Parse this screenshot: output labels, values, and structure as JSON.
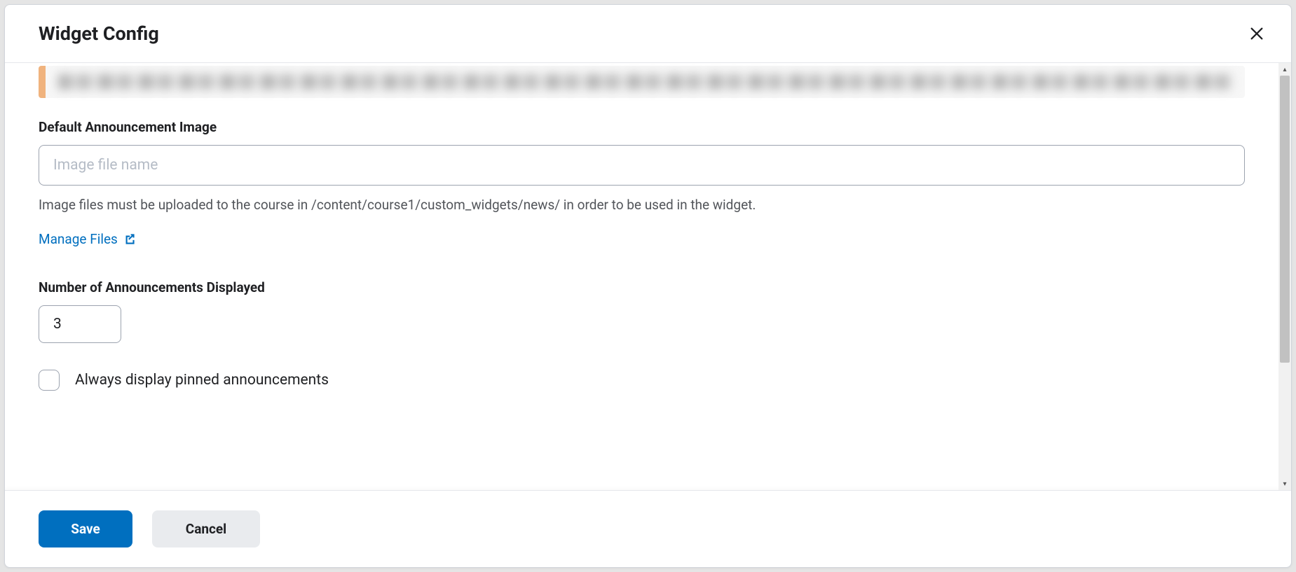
{
  "modal": {
    "title": "Widget Config"
  },
  "form": {
    "default_image_label": "Default Announcement Image",
    "default_image_placeholder": "Image file name",
    "default_image_value": "",
    "default_image_help": "Image files must be uploaded to the course in /content/course1/custom_widgets/news/ in order to be used in the widget.",
    "manage_files_link": "Manage Files",
    "num_announcements_label": "Number of Announcements Displayed",
    "num_announcements_value": "3",
    "always_pinned_label": "Always display pinned announcements"
  },
  "footer": {
    "save_label": "Save",
    "cancel_label": "Cancel"
  }
}
